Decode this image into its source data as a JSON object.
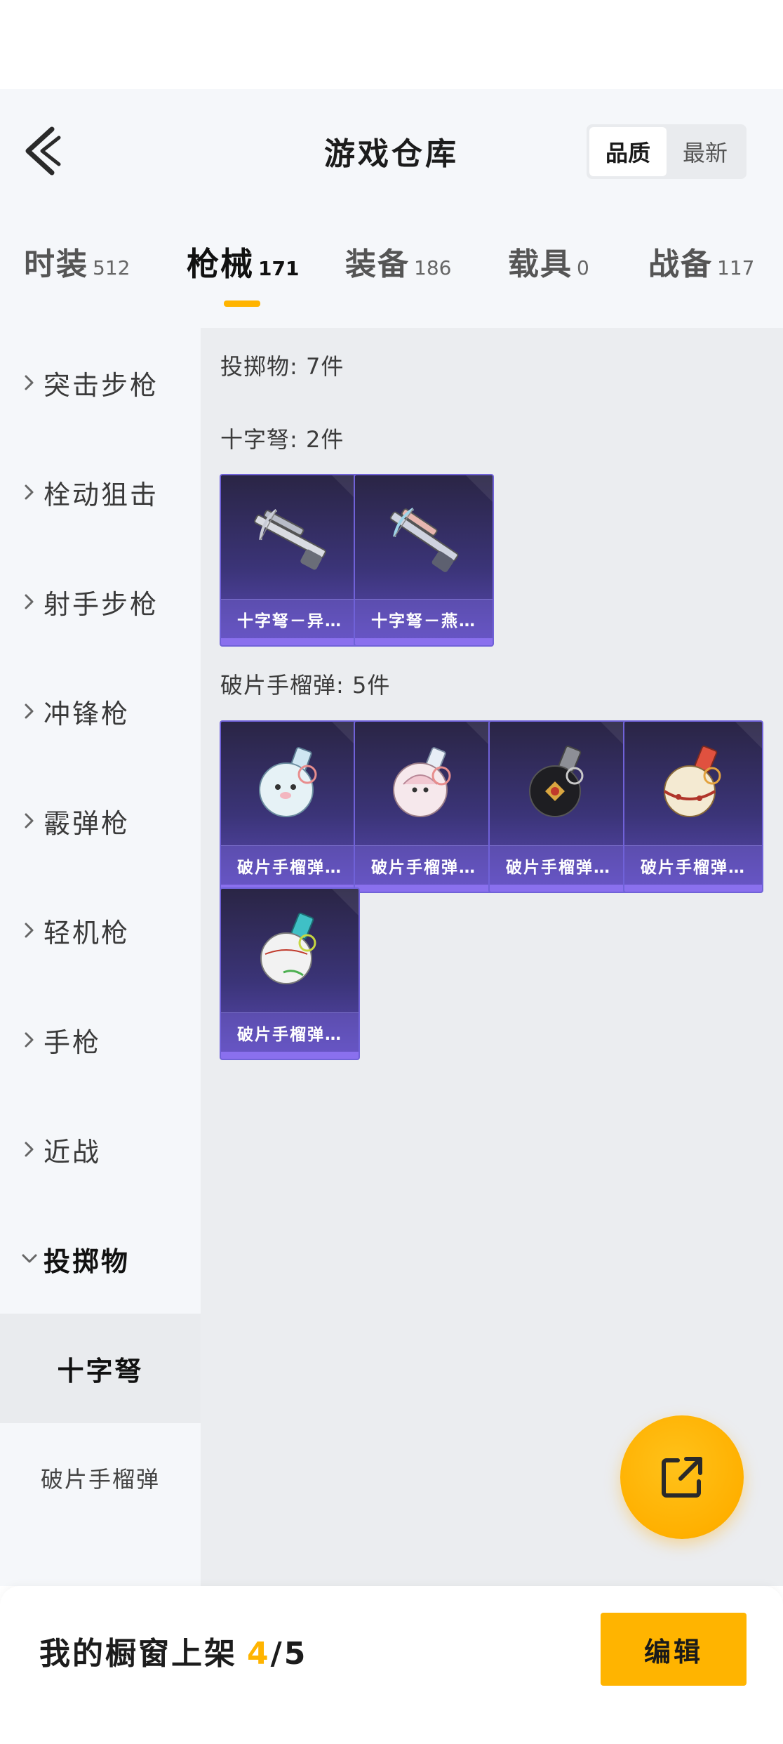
{
  "header": {
    "title": "游戏仓库",
    "sort_options": [
      "品质",
      "最新"
    ],
    "sort_selected": "品质"
  },
  "tabs": [
    {
      "label": "时装",
      "count": "512"
    },
    {
      "label": "枪械",
      "count": "171",
      "active": true
    },
    {
      "label": "装备",
      "count": "186"
    },
    {
      "label": "载具",
      "count": "0"
    },
    {
      "label": "战备",
      "count": "117"
    }
  ],
  "sidebar": {
    "items": [
      {
        "label": "突击步枪"
      },
      {
        "label": "栓动狙击"
      },
      {
        "label": "射手步枪"
      },
      {
        "label": "冲锋枪"
      },
      {
        "label": "霰弹枪"
      },
      {
        "label": "轻机枪"
      },
      {
        "label": "手枪"
      },
      {
        "label": "近战"
      },
      {
        "label": "投掷物",
        "open": true
      }
    ],
    "subitems": [
      {
        "label": "十字弩",
        "selected": true
      },
      {
        "label": "破片手榴弹"
      }
    ]
  },
  "content": {
    "groups": [
      {
        "title": "投掷物: 7件"
      },
      {
        "title": "十字弩: 2件",
        "items": [
          "十字弩－异…",
          "十字弩－燕…"
        ]
      },
      {
        "title": "破片手榴弹: 5件",
        "items": [
          "破片手榴弹…",
          "破片手榴弹…",
          "破片手榴弹…",
          "破片手榴弹…",
          "破片手榴弹…"
        ]
      }
    ]
  },
  "bottom": {
    "showcase_label": "我的橱窗上架",
    "showcase_current": "4",
    "showcase_total": "/5",
    "edit_label": "编辑"
  },
  "icons": {
    "back": "back-chevron-icon",
    "share": "share-external-icon"
  },
  "colors": {
    "accent": "#ffb400",
    "card_purple": "#5c4bb8"
  }
}
